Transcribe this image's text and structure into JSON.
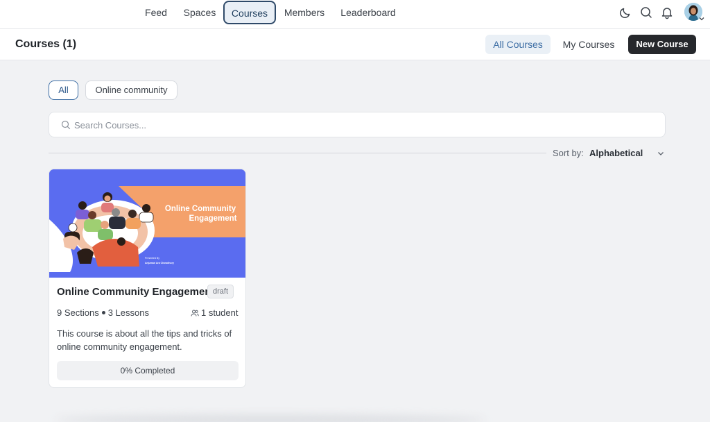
{
  "nav": {
    "items": [
      {
        "label": "Feed"
      },
      {
        "label": "Spaces"
      },
      {
        "label": "Courses",
        "active": true
      },
      {
        "label": "Members"
      },
      {
        "label": "Leaderboard"
      }
    ],
    "icons": [
      "moon-icon",
      "search-icon",
      "bell-icon",
      "avatar"
    ]
  },
  "header": {
    "title": "Courses (1)",
    "all_courses": "All Courses",
    "my_courses": "My Courses",
    "new_course": "New Course"
  },
  "filters": {
    "pills": [
      {
        "label": "All",
        "active": true
      },
      {
        "label": "Online community",
        "active": false
      }
    ]
  },
  "search": {
    "placeholder": "Search Courses..."
  },
  "sort": {
    "label": "Sort by:",
    "value": "Alphabetical"
  },
  "course": {
    "thumbnail": {
      "title_line1": "Online Community",
      "title_line2": "Engagement",
      "presented_by": "Presented By",
      "author": "Anjuman Ara Chowdhury"
    },
    "title": "Online Community Engagement",
    "status": "draft",
    "sections": "9 Sections",
    "lessons": "3 Lessons",
    "students": "1 student",
    "description": "This course is about all the tips and tricks of online community engagement.",
    "progress": 0,
    "progress_label": "0% Completed"
  },
  "colors": {
    "accent": "#3c6da4",
    "thumb_blue": "#5a6cf0",
    "thumb_orange": "#f4a16b",
    "dark_button": "#26282c"
  }
}
